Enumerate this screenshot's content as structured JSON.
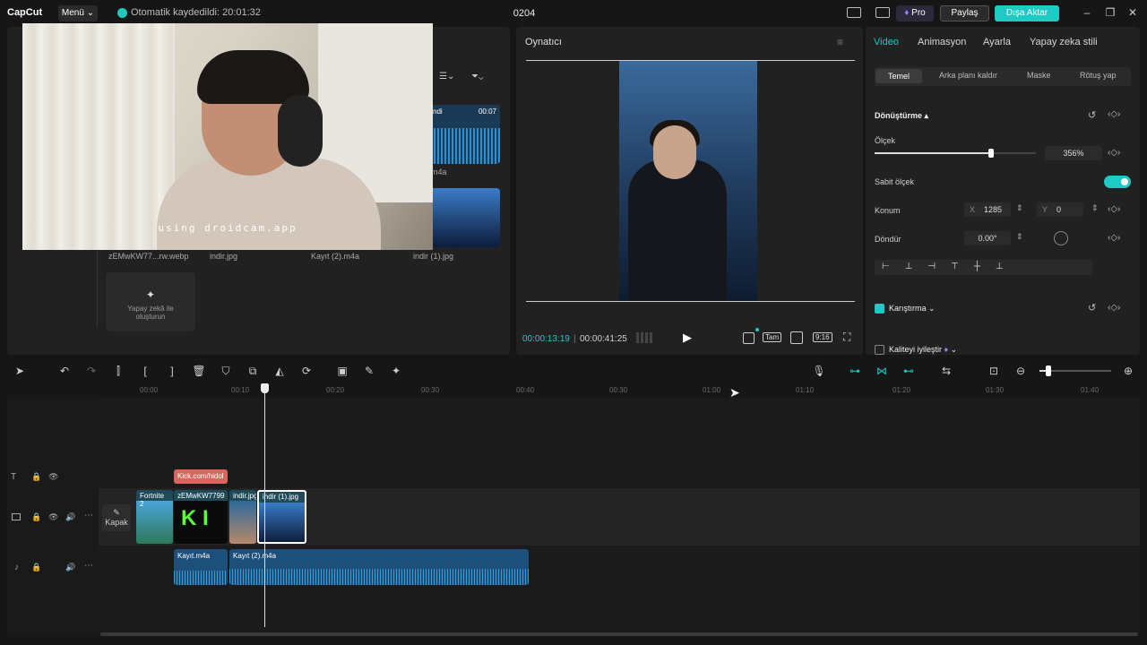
{
  "app": {
    "logo": "CapCut",
    "menu_label": "Menü",
    "autosave": "Otomatik kaydedildi: 20:01:32",
    "project_title": "0204",
    "pro_label": "Pro",
    "share_label": "Paylaş",
    "export_label": "Dışa Aktar"
  },
  "media": {
    "overlay_text": "using droidcam.app",
    "labels": [
      "zEMwKW77...rw.webp",
      "indir.jpg",
      "Kayıt (2).m4a",
      "indir (1).jpg"
    ],
    "side_label": "m4a",
    "audio_tag": "ndi",
    "duration": "00:07",
    "ai_label": "Yapay zekâ ile oluşturun"
  },
  "player": {
    "title": "Oynatıcı",
    "current_time": "00:00:13:19",
    "total_time": "00:00:41:25",
    "full_label": "Tam",
    "ratio_label": "9:16"
  },
  "right": {
    "tabs": [
      "Video",
      "Animasyon",
      "Ayarla",
      "Yapay zeka stili"
    ],
    "subtabs": [
      "Temel",
      "Arka planı kaldır",
      "Maske",
      "Rötuş yap"
    ],
    "transform_label": "Dönüştürme",
    "scale_label": "Ölçek",
    "scale_value": "356%",
    "scale_fraction": 0.72,
    "uniform_label": "Sabit ölçek",
    "position_label": "Konum",
    "x_label": "X",
    "x_value": "1285",
    "y_label": "Y",
    "y_value": "0",
    "rotate_label": "Döndür",
    "rotate_value": "0.00°",
    "blend_label": "Karıştırma",
    "enhance_label": "Kaliteyi iyileştir"
  },
  "timeline": {
    "ticks": [
      "00:00",
      "00:10",
      "00:20",
      "00:30",
      "00:40",
      "00:30",
      "01:00",
      "01:10",
      "01:20",
      "01:30",
      "01:40"
    ],
    "text_clip": "Kick.com/hidol",
    "cover_label": "Kapak",
    "clips": [
      "Fortnite 2",
      "zEMwKW7799",
      "indir.jpg",
      "indir (1).jpg"
    ],
    "audio_clips": [
      "Kayıt.m4a",
      "Kayıt (2).m4a"
    ]
  },
  "colors": {
    "accent": "#1fc9c4",
    "text_clip": "#d9665c",
    "audio": "#1c4f7a"
  }
}
